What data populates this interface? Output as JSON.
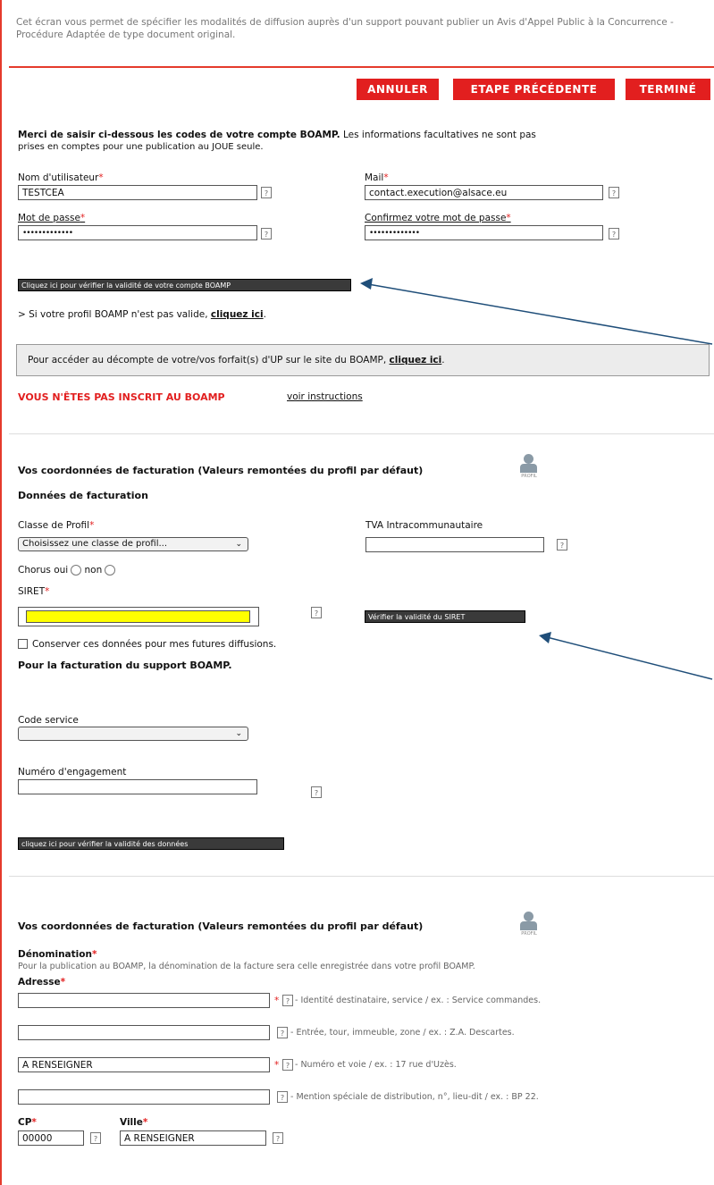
{
  "intro_text": "Cet écran vous permet de spécifier les modalités de diffusion auprès d'un support pouvant publier un Avis d'Appel Public à la Concurrence - Procédure Adaptée de type document original.",
  "buttons": {
    "cancel": "ANNULER",
    "previous": "ETAPE PRÉCÉDENTE",
    "finish": "TERMINÉ"
  },
  "boamp": {
    "instruction_bold": "Merci de saisir ci-dessous les codes de votre compte BOAMP.",
    "instruction_rest": " Les informations facultatives ne sont pas",
    "instruction_line2": "prises en comptes pour une publication au JOUE seule.",
    "username_label": "Nom d'utilisateur",
    "username_value": "TESTCEA",
    "mail_label": "Mail",
    "mail_value": "contact.execution@alsace.eu",
    "password_label": "Mot de passe",
    "password_value": "•••••••••••••",
    "confirm_label": "Confirmez votre mot de passe",
    "confirm_value": "•••••••••••••",
    "verify_button": "Cliquez ici pour vérifier la validité de votre compte BOAMP",
    "invalid_text": "> Si votre profil BOAMP n'est pas valide, ",
    "invalid_link": "cliquez ici",
    "count_text": "Pour accéder au décompte de votre/vos forfait(s) d'UP sur le site du BOAMP, ",
    "count_link": "cliquez ici",
    "not_registered": "VOUS N'ÊTES PAS INSCRIT AU BOAMP",
    "instructions_link": "voir instructions"
  },
  "billing": {
    "title": "Vos coordonnées de facturation (Valeurs remontées du profil par défaut)",
    "profil_caption": "PROFIL",
    "data_title": "Données de facturation",
    "class_label": "Classe de Profil",
    "class_value": "Choisissez une classe de profil...",
    "tva_label": "TVA Intracommunautaire",
    "chorus_label": "Chorus oui",
    "chorus_no": "non",
    "siret_label": "SIRET",
    "verify_siret": "Vérifier la validité du SIRET",
    "keep_label": "Conserver ces données pour mes futures diffusions.",
    "boamp_billing_title": "Pour la facturation du support BOAMP.",
    "service_label": "Code service",
    "engagement_label": "Numéro d'engagement",
    "verify_data": "cliquez ici pour vérifier la validité des données"
  },
  "billing2": {
    "title": "Vos coordonnées de facturation (Valeurs remontées du profil par défaut)",
    "profil_caption": "PROFIL",
    "denomination_label": "Dénomination",
    "denomination_hint": "Pour la publication au BOAMP, la dénomination de la facture sera celle enregistrée dans votre profil BOAMP.",
    "address_label": "Adresse",
    "address_lines": [
      {
        "value": "",
        "hint": " - Identité destinataire, service / ex. : Service commandes."
      },
      {
        "value": "",
        "hint": " - Entrée, tour, immeuble, zone / ex. : Z.A. Descartes."
      },
      {
        "value": "A RENSEIGNER",
        "hint": " - Numéro et voie / ex. : 17 rue d'Uzès."
      },
      {
        "value": "",
        "hint": " - Mention spéciale de distribution, n°, lieu-dit / ex. : BP 22."
      }
    ],
    "cp_label": "CP",
    "cp_value": "00000",
    "city_label": "Ville",
    "city_value": "A RENSEIGNER"
  },
  "colors": {
    "accent_red": "#e21f1f",
    "siret_highlight": "#ffff00",
    "arrow": "#1f4e79"
  },
  "help_icon": "?",
  "required_mark": "*"
}
